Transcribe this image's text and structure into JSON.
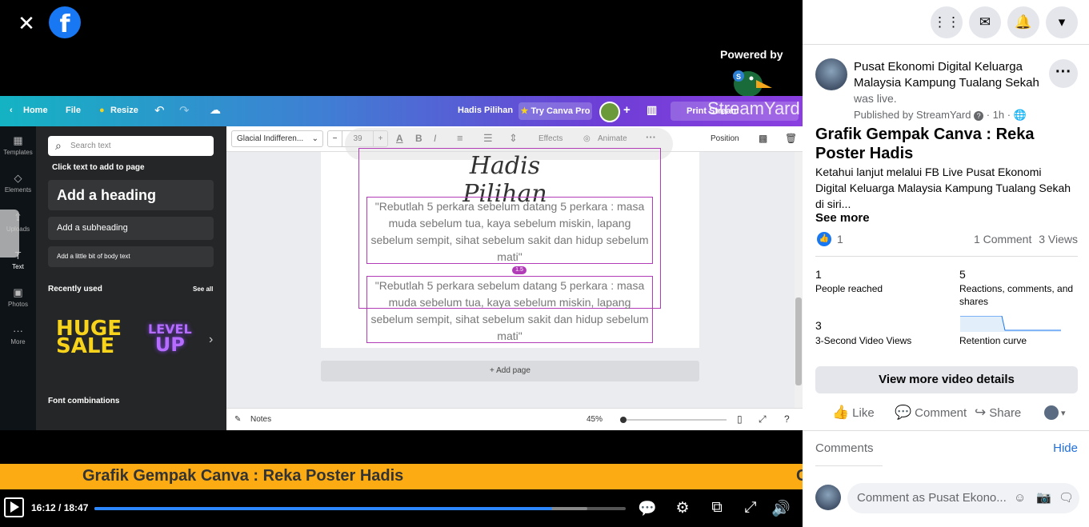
{
  "viewer": {
    "close_icon": "close-icon",
    "logo": "facebook-logo",
    "powered_by": "Powered by",
    "watermark": "StreamYard"
  },
  "canva": {
    "topbar": {
      "home": "Home",
      "file": "File",
      "resize": "Resize",
      "doc_title": "Hadis Pilihan",
      "try_pro": "Try Canva Pro",
      "print": "Print Stream"
    },
    "rail": [
      "Templates",
      "Elements",
      "Uploads",
      "Text",
      "Photos",
      "More"
    ],
    "panel": {
      "search_placeholder": "Search text",
      "click_text": "Click text to add to page",
      "heading": "Add a heading",
      "subheading": "Add a subheading",
      "body": "Add a little bit of body text",
      "recently_used": "Recently used",
      "see_all": "See all",
      "huge_sale_line1": "HUGE",
      "huge_sale_line2": "SALE",
      "level_line1": "LEVEL",
      "level_line2": "UP",
      "font_combos": "Font combinations"
    },
    "toolbar": {
      "font": "Glacial Indifferen...",
      "size": "39",
      "effects": "Effects",
      "animate": "Animate",
      "position": "Position"
    },
    "page": {
      "title": "Hadis Pilihan",
      "quote1": "\"Rebutlah 5 perkara sebelum datang 5 perkara : masa muda sebelum tua, kaya sebelum miskin, lapang sebelum sempit, sihat sebelum sakit dan hidup sebelum mati\"",
      "quote2": "\"Rebutlah 5 perkara sebelum datang 5 perkara : masa muda sebelum tua, kaya sebelum miskin, lapang sebelum sempit, sihat sebelum sakit dan hidup sebelum mati\"",
      "spacing_badge": "1.5",
      "add_page": "+ Add page"
    },
    "bottom": {
      "notes": "Notes",
      "zoom": "45%"
    }
  },
  "ticker": {
    "text": "Grafik Gempak Canva : Reka Poster Hadis",
    "next_char": "C"
  },
  "player": {
    "time": "16:12 / 18:47",
    "played_fraction": 0.862,
    "buffered_fraction": 0.928
  },
  "sidebar": {
    "page_name": "Pusat Ekonomi Digital Keluarga Malaysia Kampung Tualang Sekah",
    "was_live": "was live.",
    "published_by": "Published by StreamYard",
    "age": "1h",
    "title": "Grafik Gempak Canva : Reka Poster Hadis",
    "description": "Ketahui lanjut melalui FB Live Pusat Ekonomi Digital Keluarga Malaysia Kampung Tualang Sekah di siri...",
    "see_more": "See more",
    "reactions": "1",
    "comments_count": "1 Comment",
    "views": "3 Views",
    "insights": {
      "reached_num": "1",
      "reached_label": "People reached",
      "reactions_num": "5",
      "reactions_label": "Reactions, comments, and shares",
      "views3s_num": "3",
      "views3s_label": "3-Second Video Views",
      "retention_label": "Retention curve"
    },
    "view_more_details": "View more video details",
    "actions": {
      "like": "Like",
      "comment": "Comment",
      "share": "Share"
    },
    "comments_header": "Comments",
    "hide": "Hide",
    "comment_placeholder": "Comment as Pusat Ekono..."
  },
  "colors": {
    "fb_blue": "#1877f2",
    "ticker_orange": "#fcac12",
    "canva_gradient_start": "#14b3c3",
    "canva_gradient_end": "#8b3fe0"
  }
}
